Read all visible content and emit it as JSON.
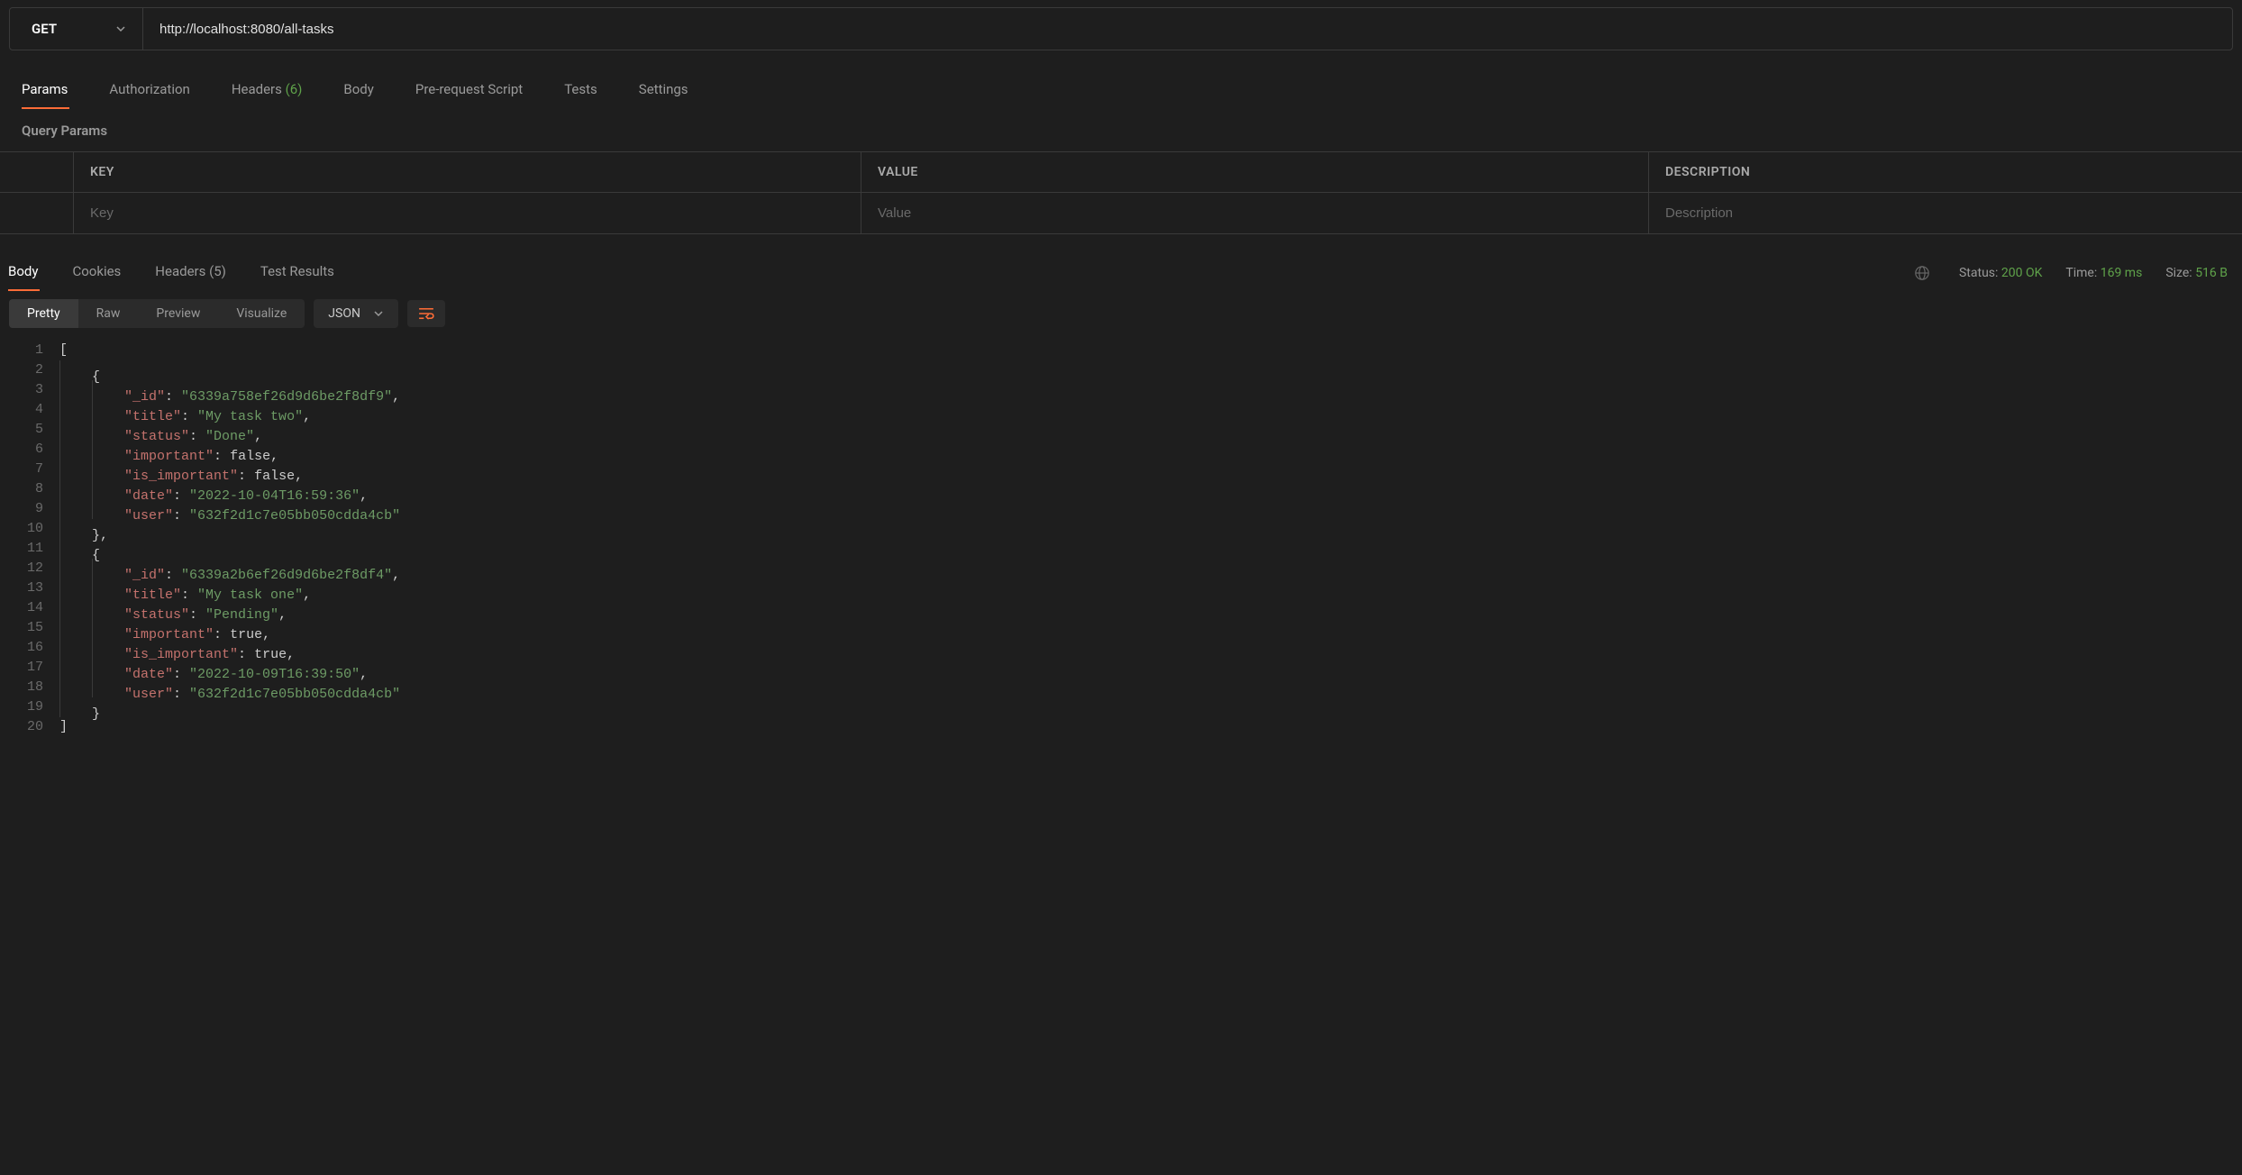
{
  "request": {
    "method": "GET",
    "url": "http://localhost:8080/all-tasks"
  },
  "request_tabs": [
    {
      "label": "Params",
      "active": true
    },
    {
      "label": "Authorization",
      "active": false
    },
    {
      "label": "Headers",
      "count": "(6)",
      "active": false
    },
    {
      "label": "Body",
      "active": false
    },
    {
      "label": "Pre-request Script",
      "active": false
    },
    {
      "label": "Tests",
      "active": false
    },
    {
      "label": "Settings",
      "active": false
    }
  ],
  "params_section_label": "Query Params",
  "params_headers": {
    "key": "KEY",
    "value": "VALUE",
    "desc": "DESCRIPTION"
  },
  "params_placeholders": {
    "key": "Key",
    "value": "Value",
    "desc": "Description"
  },
  "response_tabs": [
    {
      "label": "Body",
      "active": true
    },
    {
      "label": "Cookies",
      "active": false
    },
    {
      "label": "Headers",
      "count": "(5)",
      "active": false
    },
    {
      "label": "Test Results",
      "active": false
    }
  ],
  "response_meta": {
    "status_label": "Status:",
    "status_value": "200 OK",
    "time_label": "Time:",
    "time_value": "169 ms",
    "size_label": "Size:",
    "size_value": "516 B"
  },
  "view_tabs": [
    {
      "label": "Pretty",
      "active": true
    },
    {
      "label": "Raw",
      "active": false
    },
    {
      "label": "Preview",
      "active": false
    },
    {
      "label": "Visualize",
      "active": false
    }
  ],
  "format_label": "JSON",
  "response_body": [
    {
      "_id": "6339a758ef26d9d6be2f8df9",
      "title": "My task two",
      "status": "Done",
      "important": false,
      "is_important": false,
      "date": "2022-10-04T16:59:36",
      "user": "632f2d1c7e05bb050cdda4cb"
    },
    {
      "_id": "6339a2b6ef26d9d6be2f8df4",
      "title": "My task one",
      "status": "Pending",
      "important": true,
      "is_important": true,
      "date": "2022-10-09T16:39:50",
      "user": "632f2d1c7e05bb050cdda4cb"
    }
  ],
  "code_lines": [
    {
      "n": 1,
      "indent": 0,
      "tokens": [
        {
          "t": "[",
          "c": "punc"
        }
      ]
    },
    {
      "n": 2,
      "indent": 1,
      "tokens": [
        {
          "t": "{",
          "c": "punc"
        }
      ]
    },
    {
      "n": 3,
      "indent": 2,
      "tokens": [
        {
          "t": "\"_id\"",
          "c": "key"
        },
        {
          "t": ": ",
          "c": "punc"
        },
        {
          "t": "\"6339a758ef26d9d6be2f8df9\"",
          "c": "str"
        },
        {
          "t": ",",
          "c": "punc"
        }
      ]
    },
    {
      "n": 4,
      "indent": 2,
      "tokens": [
        {
          "t": "\"title\"",
          "c": "key"
        },
        {
          "t": ": ",
          "c": "punc"
        },
        {
          "t": "\"My task two\"",
          "c": "str"
        },
        {
          "t": ",",
          "c": "punc"
        }
      ]
    },
    {
      "n": 5,
      "indent": 2,
      "tokens": [
        {
          "t": "\"status\"",
          "c": "key"
        },
        {
          "t": ": ",
          "c": "punc"
        },
        {
          "t": "\"Done\"",
          "c": "str"
        },
        {
          "t": ",",
          "c": "punc"
        }
      ]
    },
    {
      "n": 6,
      "indent": 2,
      "tokens": [
        {
          "t": "\"important\"",
          "c": "key"
        },
        {
          "t": ": ",
          "c": "punc"
        },
        {
          "t": "false",
          "c": "bool"
        },
        {
          "t": ",",
          "c": "punc"
        }
      ]
    },
    {
      "n": 7,
      "indent": 2,
      "tokens": [
        {
          "t": "\"is_important\"",
          "c": "key"
        },
        {
          "t": ": ",
          "c": "punc"
        },
        {
          "t": "false",
          "c": "bool"
        },
        {
          "t": ",",
          "c": "punc"
        }
      ]
    },
    {
      "n": 8,
      "indent": 2,
      "tokens": [
        {
          "t": "\"date\"",
          "c": "key"
        },
        {
          "t": ": ",
          "c": "punc"
        },
        {
          "t": "\"2022-10-04T16:59:36\"",
          "c": "str"
        },
        {
          "t": ",",
          "c": "punc"
        }
      ]
    },
    {
      "n": 9,
      "indent": 2,
      "tokens": [
        {
          "t": "\"user\"",
          "c": "key"
        },
        {
          "t": ": ",
          "c": "punc"
        },
        {
          "t": "\"632f2d1c7e05bb050cdda4cb\"",
          "c": "str"
        }
      ]
    },
    {
      "n": 10,
      "indent": 1,
      "tokens": [
        {
          "t": "},",
          "c": "punc"
        }
      ]
    },
    {
      "n": 11,
      "indent": 1,
      "tokens": [
        {
          "t": "{",
          "c": "punc"
        }
      ]
    },
    {
      "n": 12,
      "indent": 2,
      "tokens": [
        {
          "t": "\"_id\"",
          "c": "key"
        },
        {
          "t": ": ",
          "c": "punc"
        },
        {
          "t": "\"6339a2b6ef26d9d6be2f8df4\"",
          "c": "str"
        },
        {
          "t": ",",
          "c": "punc"
        }
      ]
    },
    {
      "n": 13,
      "indent": 2,
      "tokens": [
        {
          "t": "\"title\"",
          "c": "key"
        },
        {
          "t": ": ",
          "c": "punc"
        },
        {
          "t": "\"My task one\"",
          "c": "str"
        },
        {
          "t": ",",
          "c": "punc"
        }
      ]
    },
    {
      "n": 14,
      "indent": 2,
      "tokens": [
        {
          "t": "\"status\"",
          "c": "key"
        },
        {
          "t": ": ",
          "c": "punc"
        },
        {
          "t": "\"Pending\"",
          "c": "str"
        },
        {
          "t": ",",
          "c": "punc"
        }
      ]
    },
    {
      "n": 15,
      "indent": 2,
      "tokens": [
        {
          "t": "\"important\"",
          "c": "key"
        },
        {
          "t": ": ",
          "c": "punc"
        },
        {
          "t": "true",
          "c": "bool"
        },
        {
          "t": ",",
          "c": "punc"
        }
      ]
    },
    {
      "n": 16,
      "indent": 2,
      "tokens": [
        {
          "t": "\"is_important\"",
          "c": "key"
        },
        {
          "t": ": ",
          "c": "punc"
        },
        {
          "t": "true",
          "c": "bool"
        },
        {
          "t": ",",
          "c": "punc"
        }
      ]
    },
    {
      "n": 17,
      "indent": 2,
      "tokens": [
        {
          "t": "\"date\"",
          "c": "key"
        },
        {
          "t": ": ",
          "c": "punc"
        },
        {
          "t": "\"2022-10-09T16:39:50\"",
          "c": "str"
        },
        {
          "t": ",",
          "c": "punc"
        }
      ]
    },
    {
      "n": 18,
      "indent": 2,
      "tokens": [
        {
          "t": "\"user\"",
          "c": "key"
        },
        {
          "t": ": ",
          "c": "punc"
        },
        {
          "t": "\"632f2d1c7e05bb050cdda4cb\"",
          "c": "str"
        }
      ]
    },
    {
      "n": 19,
      "indent": 1,
      "tokens": [
        {
          "t": "}",
          "c": "punc"
        }
      ]
    },
    {
      "n": 20,
      "indent": 0,
      "tokens": [
        {
          "t": "]",
          "c": "punc"
        }
      ]
    }
  ]
}
